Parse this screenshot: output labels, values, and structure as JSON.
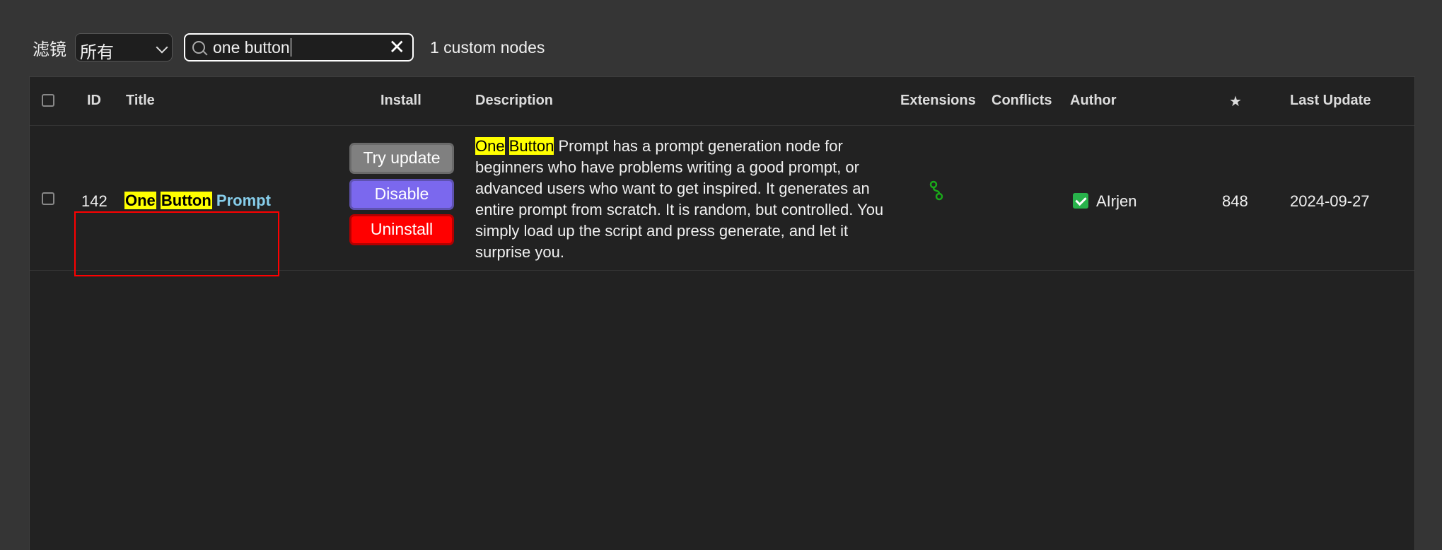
{
  "toolbar": {
    "filter_label": "滤镜",
    "filter_selected": "所有",
    "search_value": "one button",
    "result_count": "1 custom nodes"
  },
  "table": {
    "headers": {
      "id": "ID",
      "title": "Title",
      "install": "Install",
      "description": "Description",
      "extensions": "Extensions",
      "conflicts": "Conflicts",
      "author": "Author",
      "stars": "★",
      "last_update": "Last Update"
    },
    "rows": [
      {
        "id": "142",
        "title_parts": [
          "One",
          "Button",
          "Prompt"
        ],
        "buttons": {
          "try_update": "Try update",
          "disable": "Disable",
          "uninstall": "Uninstall"
        },
        "description_hl1": "One",
        "description_hl2": "Button",
        "description_rest": " Prompt has a prompt generation node for beginners who have problems writing a good prompt, or advanced users who want to get inspired. It generates an entire prompt from scratch. It is random, but controlled. You simply load up the script and press generate, and let it surprise you.",
        "extensions_icon": "node-graph-icon",
        "conflicts": "",
        "author": "AIrjen",
        "stars": "848",
        "last_update": "2024-09-27"
      }
    ]
  },
  "colors": {
    "background": "#353535",
    "table_bg": "#222222",
    "highlight": "#ffff00",
    "title_link": "#87ceeb",
    "disable_button": "#7b68ee",
    "uninstall_button": "#ff0000",
    "update_button": "#808080",
    "selection_box": "#ff0000"
  }
}
